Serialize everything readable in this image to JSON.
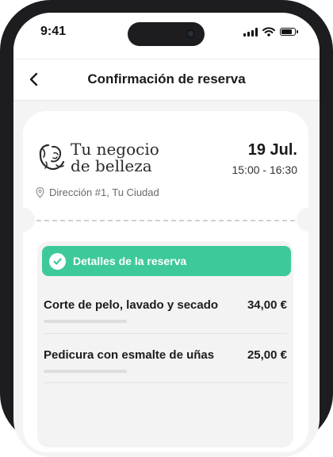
{
  "status_bar": {
    "time": "9:41"
  },
  "header": {
    "title": "Confirmación de reserva"
  },
  "business": {
    "name_line1": "Tu negocio",
    "name_line2": "de belleza",
    "date": "19 Jul.",
    "time_range": "15:00 - 16:30",
    "address": "Dirección #1, Tu Ciudad"
  },
  "details": {
    "title": "Detalles de la reserva",
    "accent_color": "#3ec99a",
    "services": [
      {
        "name": "Corte de pelo, lavado y secado",
        "price": "34,00 €"
      },
      {
        "name": "Pedicura con esmalte de uñas",
        "price": "25,00 €"
      }
    ]
  },
  "icons": [
    "back-arrow-icon",
    "location-pin-icon",
    "check-icon",
    "signal-icon",
    "wifi-icon",
    "battery-icon",
    "woman-face-logo-icon"
  ]
}
